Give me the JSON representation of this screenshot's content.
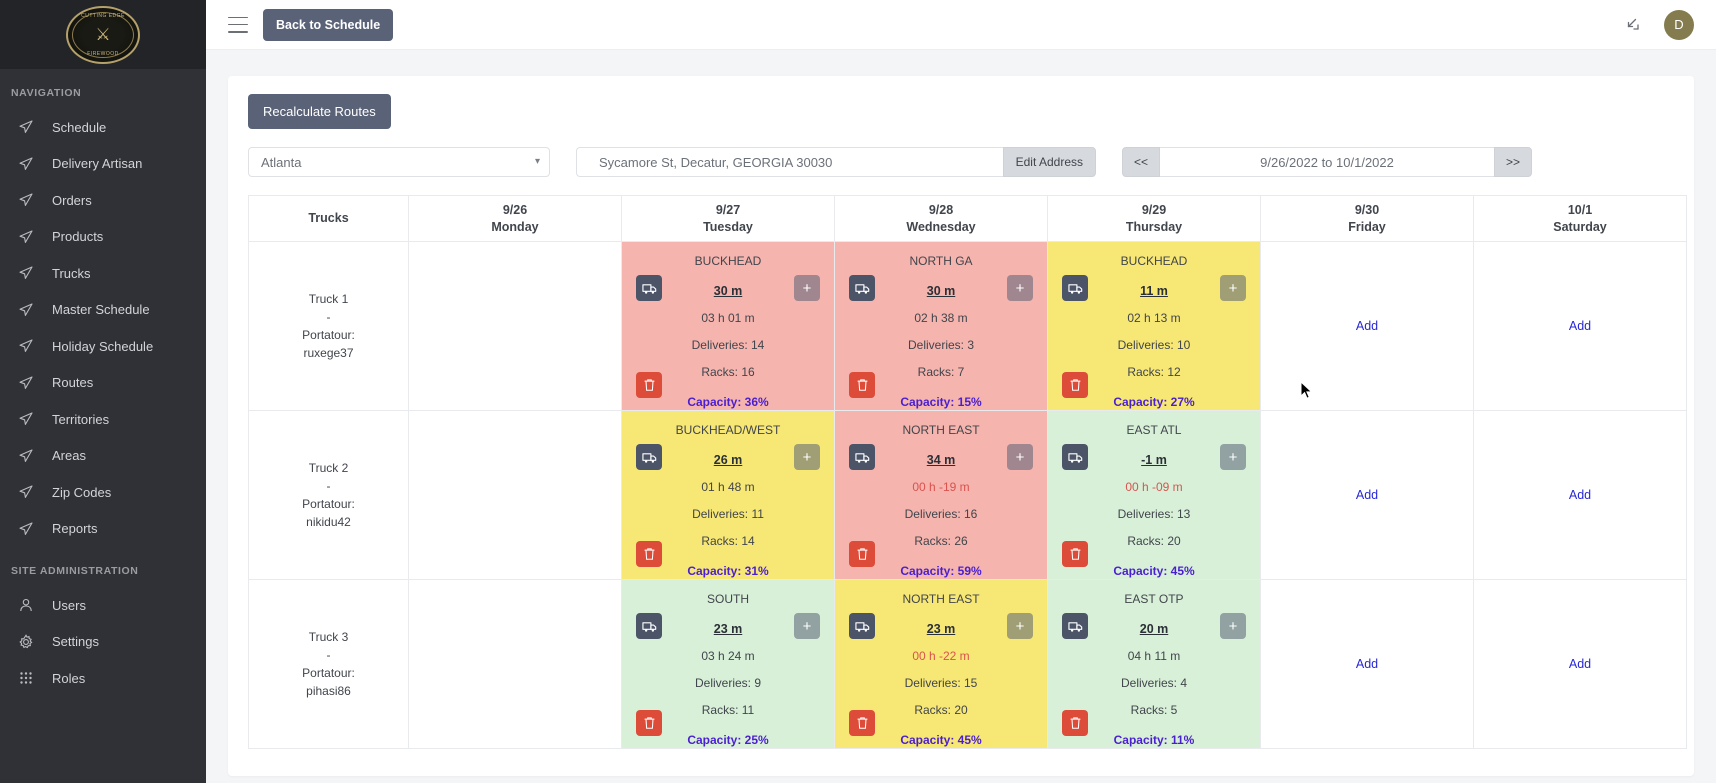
{
  "sidebar": {
    "logo": {
      "top_text": "CUTTING EDGE",
      "bottom_text": "FIREWOOD"
    },
    "nav_heading": "NAVIGATION",
    "items": [
      {
        "label": "Schedule",
        "icon": "navigation-arrow-icon"
      },
      {
        "label": "Delivery Artisan",
        "icon": "navigation-arrow-icon"
      },
      {
        "label": "Orders",
        "icon": "navigation-arrow-icon"
      },
      {
        "label": "Products",
        "icon": "navigation-arrow-icon"
      },
      {
        "label": "Trucks",
        "icon": "navigation-arrow-icon"
      },
      {
        "label": "Master Schedule",
        "icon": "navigation-arrow-icon"
      },
      {
        "label": "Holiday Schedule",
        "icon": "navigation-arrow-icon"
      },
      {
        "label": "Routes",
        "icon": "navigation-arrow-icon"
      },
      {
        "label": "Territories",
        "icon": "navigation-arrow-icon"
      },
      {
        "label": "Areas",
        "icon": "navigation-arrow-icon"
      },
      {
        "label": "Zip Codes",
        "icon": "navigation-arrow-icon"
      },
      {
        "label": "Reports",
        "icon": "navigation-arrow-icon"
      }
    ],
    "admin_heading": "SITE ADMINISTRATION",
    "admin_items": [
      {
        "label": "Users",
        "icon": "user-icon"
      },
      {
        "label": "Settings",
        "icon": "gear-icon"
      },
      {
        "label": "Roles",
        "icon": "grid-dots-icon"
      }
    ]
  },
  "topbar": {
    "menu_icon": "hamburger-icon",
    "back_label": "Back to Schedule",
    "expand_icon": "expand-diagonal-icon",
    "avatar_initial": "D"
  },
  "toolbar": {
    "recalculate_label": "Recalculate Routes",
    "city_selected": "Atlanta",
    "address_value": "Sycamore St, Decatur, GEORGIA 30030",
    "edit_address_label": "Edit Address",
    "prev_label": "<<",
    "next_label": ">>",
    "date_range": "9/26/2022 to 10/1/2022"
  },
  "table": {
    "header": [
      {
        "date": "",
        "day": "Trucks"
      },
      {
        "date": "9/26",
        "day": "Monday"
      },
      {
        "date": "9/27",
        "day": "Tuesday"
      },
      {
        "date": "9/28",
        "day": "Wednesday"
      },
      {
        "date": "9/29",
        "day": "Thursday"
      },
      {
        "date": "9/30",
        "day": "Friday"
      },
      {
        "date": "10/1",
        "day": "Saturday"
      }
    ],
    "add_label": "Add",
    "rows": [
      {
        "truck": "Truck 1 - Portatour: ruxege37",
        "truck_name": "Truck 1",
        "truck_dash": "-",
        "truck_portatour": "Portatour: ruxege37",
        "cells": [
          {
            "type": "empty"
          },
          {
            "type": "route",
            "color": "bg-red",
            "title": "BUCKHEAD",
            "metric": "30 m",
            "duration": "03 h 01 m",
            "duration_negative": false,
            "deliveries": "Deliveries: 14",
            "racks": "Racks: 16",
            "capacity": "Capacity: 36%"
          },
          {
            "type": "route",
            "color": "bg-red",
            "title": "NORTH GA",
            "metric": "30 m",
            "duration": "02 h 38 m",
            "duration_negative": false,
            "deliveries": "Deliveries: 3",
            "racks": "Racks: 7",
            "capacity": "Capacity: 15%"
          },
          {
            "type": "route",
            "color": "bg-yellow",
            "title": "BUCKHEAD",
            "metric": "11 m",
            "duration": "02 h 13 m",
            "duration_negative": false,
            "deliveries": "Deliveries: 10",
            "racks": "Racks: 12",
            "capacity": "Capacity: 27%"
          },
          {
            "type": "add"
          },
          {
            "type": "add"
          }
        ]
      },
      {
        "truck": "Truck 2 - Portatour: nikidu42",
        "truck_name": "Truck 2",
        "truck_dash": "-",
        "truck_portatour": "Portatour: nikidu42",
        "cells": [
          {
            "type": "empty"
          },
          {
            "type": "route",
            "color": "bg-yellow",
            "title": "BUCKHEAD/WEST",
            "metric": "26 m",
            "duration": "01 h 48 m",
            "duration_negative": false,
            "deliveries": "Deliveries: 11",
            "racks": "Racks: 14",
            "capacity": "Capacity: 31%"
          },
          {
            "type": "route",
            "color": "bg-red",
            "title": "NORTH EAST",
            "metric": "34 m",
            "duration": "00 h -19 m",
            "duration_negative": true,
            "deliveries": "Deliveries: 16",
            "racks": "Racks: 26",
            "capacity": "Capacity: 59%"
          },
          {
            "type": "route",
            "color": "bg-green",
            "title": "EAST ATL",
            "metric": "-1 m",
            "duration": "00 h -09 m",
            "duration_negative": true,
            "deliveries": "Deliveries: 13",
            "racks": "Racks: 20",
            "capacity": "Capacity: 45%"
          },
          {
            "type": "add"
          },
          {
            "type": "add"
          }
        ]
      },
      {
        "truck": "Truck 3 - Portatour: pihasi86",
        "truck_name": "Truck 3",
        "truck_dash": "-",
        "truck_portatour": "Portatour: pihasi86",
        "cells": [
          {
            "type": "empty"
          },
          {
            "type": "route",
            "color": "bg-green",
            "title": "SOUTH",
            "metric": "23 m",
            "duration": "03 h 24 m",
            "duration_negative": false,
            "deliveries": "Deliveries: 9",
            "racks": "Racks: 11",
            "capacity": "Capacity: 25%"
          },
          {
            "type": "route",
            "color": "bg-yellow",
            "title": "NORTH EAST",
            "metric": "23 m",
            "duration": "00 h -22 m",
            "duration_negative": true,
            "deliveries": "Deliveries: 15",
            "racks": "Racks: 20",
            "capacity": "Capacity: 45%"
          },
          {
            "type": "route",
            "color": "bg-green",
            "title": "EAST OTP",
            "metric": "20 m",
            "duration": "04 h 11 m",
            "duration_negative": false,
            "deliveries": "Deliveries: 4",
            "racks": "Racks: 5",
            "capacity": "Capacity: 11%"
          },
          {
            "type": "add"
          },
          {
            "type": "add"
          }
        ]
      }
    ]
  },
  "colors": {
    "accent": "#5a6277",
    "capacity_text": "#4a1fd0",
    "link": "#2727d4",
    "negative": "#d9534f",
    "red_cell": "#f5b4ad",
    "yellow_cell": "#f7e774",
    "green_cell": "#d8f0d8",
    "avatar_bg": "#847c4e"
  }
}
